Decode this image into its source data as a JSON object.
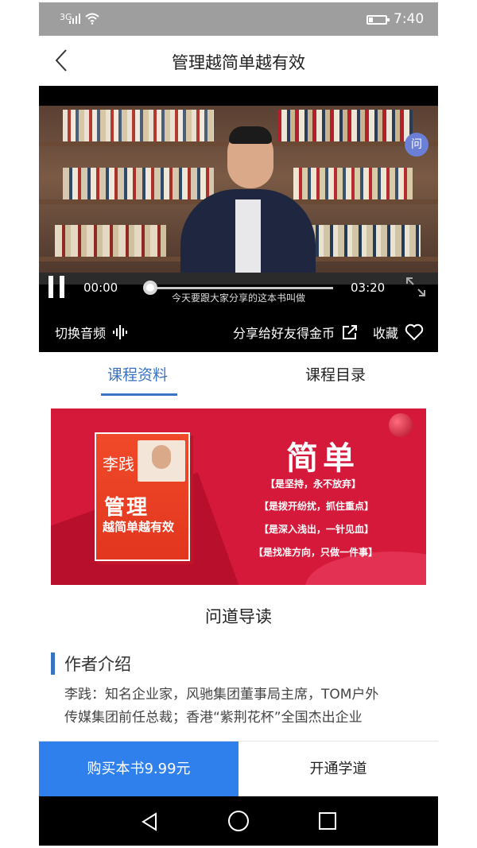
{
  "status_bar": {
    "signal_label": "3G",
    "time": "7:40"
  },
  "header": {
    "title": "管理越简单越有效"
  },
  "video": {
    "current_time": "00:00",
    "duration": "03:20",
    "progress": 0.0,
    "subtitle": "今天要跟大家分享的这本书叫做",
    "audio_switch_label": "切换音频",
    "share_label": "分享给好友得金币",
    "collect_label": "收藏"
  },
  "tabs": [
    {
      "label": "课程资料",
      "active": true
    },
    {
      "label": "课程目录",
      "active": false
    }
  ],
  "banner": {
    "book_author": "李践",
    "book_title_1": "管理",
    "book_title_2": "越简单越有效",
    "headline": "简单",
    "lines": [
      "【是坚持，永不放弃】",
      "【是拨开纷扰，抓住重点】",
      "【是深入浅出，一针见血】",
      "【是找准方向，只做一件事】"
    ]
  },
  "guide_title": "问道导读",
  "author_section": {
    "heading": "作者介绍",
    "line1": "李践：知名企业家，风驰集团董事局主席，TOM户外",
    "line2": "传媒集团前任总裁；香港“紫荆花杯”全国杰出企业"
  },
  "buy_bar": {
    "buy_label": "购买本书9.99元",
    "open_label": "开通学道"
  },
  "colors": {
    "accent": "#3a73c2",
    "buy_button": "#2f80ed",
    "banner_red": "#d5193a"
  }
}
